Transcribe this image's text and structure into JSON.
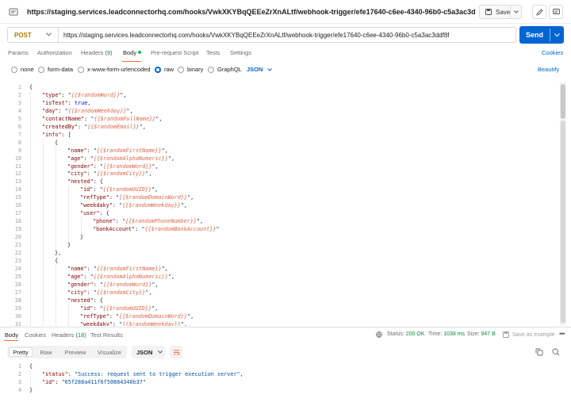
{
  "title_bar": {
    "url": "https://staging.services.leadconnectorhq.com/hooks/VwkXKYBqQEEeZrXnALtf/webhook-trigger/efe17640-c6ee-4340-96b0-c5a3ac3d",
    "save_label": "Save"
  },
  "request": {
    "method": "POST",
    "url": "https://staging.services.leadconnectorhq.com/hooks/VwkXKYBqQEEeZrXnALtf/webhook-trigger/efe17640-c6ee-4340-96b0-c5a3ac3ddf8f",
    "send_label": "Send"
  },
  "request_tabs": {
    "params": "Params",
    "authorization": "Authorization",
    "headers": "Headers",
    "headers_count": "(9)",
    "body": "Body",
    "pre_request": "Pre-request Script",
    "tests": "Tests",
    "settings": "Settings",
    "cookies": "Cookies"
  },
  "body_types": {
    "none": "none",
    "form_data": "form-data",
    "urlencoded": "x-www-form-urlencoded",
    "raw": "raw",
    "binary": "binary",
    "graphql": "GraphQL",
    "format": "JSON",
    "beautify": "Beautify"
  },
  "body_code": [
    {
      "n": "1",
      "t": [
        [
          "p",
          "{"
        ]
      ]
    },
    {
      "n": "2",
      "t": [
        [
          "k",
          "\"type\""
        ],
        [
          "p",
          ": "
        ],
        [
          "s",
          "\""
        ],
        [
          "v",
          "{{$randomWord}}"
        ],
        [
          "s",
          "\""
        ],
        [
          "p",
          ","
        ]
      ]
    },
    {
      "n": "3",
      "t": [
        [
          "k",
          "\"isTest\""
        ],
        [
          "p",
          ": "
        ],
        [
          "b",
          "true"
        ],
        [
          "p",
          ","
        ]
      ]
    },
    {
      "n": "4",
      "t": [
        [
          "k",
          "\"day\""
        ],
        [
          "p",
          ": "
        ],
        [
          "s",
          "\""
        ],
        [
          "v",
          "{{$randomWeekday}}"
        ],
        [
          "s",
          "\""
        ],
        [
          "p",
          ","
        ]
      ]
    },
    {
      "n": "5",
      "t": [
        [
          "k",
          "\"contactName\""
        ],
        [
          "p",
          ": "
        ],
        [
          "s",
          "\""
        ],
        [
          "v",
          "{{$randomFullName}}"
        ],
        [
          "s",
          "\""
        ],
        [
          "p",
          ","
        ]
      ]
    },
    {
      "n": "6",
      "t": [
        [
          "k",
          "\"createdBy\""
        ],
        [
          "p",
          ": "
        ],
        [
          "s",
          "\""
        ],
        [
          "v",
          "{{$randomEmail}}"
        ],
        [
          "s",
          "\""
        ],
        [
          "p",
          ","
        ]
      ]
    },
    {
      "n": "7",
      "t": [
        [
          "k",
          "\"info\""
        ],
        [
          "p",
          ": ["
        ]
      ]
    },
    {
      "n": "8",
      "t": [
        [
          "p",
          "{"
        ]
      ]
    },
    {
      "n": "9",
      "t": [
        [
          "k",
          "\"name\""
        ],
        [
          "p",
          ": "
        ],
        [
          "s",
          "\""
        ],
        [
          "v",
          "{{$randomFirstName}}"
        ],
        [
          "s",
          "\""
        ],
        [
          "p",
          ","
        ]
      ]
    },
    {
      "n": "10",
      "t": [
        [
          "k",
          "\"age\""
        ],
        [
          "p",
          ": "
        ],
        [
          "s",
          "\""
        ],
        [
          "v",
          "{{$randomAlphaNumeric}}"
        ],
        [
          "s",
          "\""
        ],
        [
          "p",
          ","
        ]
      ]
    },
    {
      "n": "11",
      "t": [
        [
          "k",
          "\"gender\""
        ],
        [
          "p",
          ": "
        ],
        [
          "s",
          "\""
        ],
        [
          "v",
          "{{$randomWord}}"
        ],
        [
          "s",
          "\""
        ],
        [
          "p",
          ","
        ]
      ]
    },
    {
      "n": "12",
      "t": [
        [
          "k",
          "\"city\""
        ],
        [
          "p",
          ": "
        ],
        [
          "s",
          "\""
        ],
        [
          "v",
          "{{$randomCity}}"
        ],
        [
          "s",
          "\""
        ],
        [
          "p",
          ","
        ]
      ]
    },
    {
      "n": "13",
      "t": [
        [
          "k",
          "\"nested\""
        ],
        [
          "p",
          ": {"
        ]
      ]
    },
    {
      "n": "14",
      "t": [
        [
          "k",
          "\"id\""
        ],
        [
          "p",
          ": "
        ],
        [
          "s",
          "\""
        ],
        [
          "v",
          "{{$randomUUID}}"
        ],
        [
          "s",
          "\""
        ],
        [
          "p",
          ","
        ]
      ]
    },
    {
      "n": "15",
      "t": [
        [
          "k",
          "\"refType\""
        ],
        [
          "p",
          ": "
        ],
        [
          "s",
          "\""
        ],
        [
          "v",
          "{{$randomDomainWord}}"
        ],
        [
          "s",
          "\""
        ],
        [
          "p",
          ","
        ]
      ]
    },
    {
      "n": "16",
      "t": [
        [
          "k",
          "\"weekdaky\""
        ],
        [
          "p",
          ": "
        ],
        [
          "s",
          "\""
        ],
        [
          "v",
          "{{$randomWeekday}}"
        ],
        [
          "s",
          "\""
        ],
        [
          "p",
          ","
        ]
      ]
    },
    {
      "n": "17",
      "t": [
        [
          "k",
          "\"user\""
        ],
        [
          "p",
          ": {"
        ]
      ]
    },
    {
      "n": "18",
      "t": [
        [
          "k",
          "\"phone\""
        ],
        [
          "p",
          ": "
        ],
        [
          "s",
          "\""
        ],
        [
          "v",
          "{{$randomPhoneNumber}}"
        ],
        [
          "s",
          "\""
        ],
        [
          "p",
          ","
        ]
      ]
    },
    {
      "n": "19",
      "t": [
        [
          "k",
          "\"bankAccount\""
        ],
        [
          "p",
          ": "
        ],
        [
          "s",
          "\""
        ],
        [
          "v",
          "{{$randomBankAccount}}"
        ],
        [
          "s",
          "\""
        ]
      ]
    },
    {
      "n": "20",
      "t": [
        [
          "p",
          "}"
        ]
      ]
    },
    {
      "n": "21",
      "t": [
        [
          "p",
          "}"
        ]
      ]
    },
    {
      "n": "22",
      "t": [
        [
          "p",
          "},"
        ]
      ]
    },
    {
      "n": "23",
      "t": [
        [
          "p",
          "{"
        ]
      ]
    },
    {
      "n": "24",
      "t": [
        [
          "k",
          "\"name\""
        ],
        [
          "p",
          ": "
        ],
        [
          "s",
          "\""
        ],
        [
          "v",
          "{{$randomFirstName}}"
        ],
        [
          "s",
          "\""
        ],
        [
          "p",
          ","
        ]
      ]
    },
    {
      "n": "25",
      "t": [
        [
          "k",
          "\"age\""
        ],
        [
          "p",
          ": "
        ],
        [
          "s",
          "\""
        ],
        [
          "v",
          "{{$randomAlphaNumeric}}"
        ],
        [
          "s",
          "\""
        ],
        [
          "p",
          ","
        ]
      ]
    },
    {
      "n": "26",
      "t": [
        [
          "k",
          "\"gender\""
        ],
        [
          "p",
          ": "
        ],
        [
          "s",
          "\""
        ],
        [
          "v",
          "{{$randomWord}}"
        ],
        [
          "s",
          "\""
        ],
        [
          "p",
          ","
        ]
      ]
    },
    {
      "n": "27",
      "t": [
        [
          "k",
          "\"city\""
        ],
        [
          "p",
          ": "
        ],
        [
          "s",
          "\""
        ],
        [
          "v",
          "{{$randomCity}}"
        ],
        [
          "s",
          "\""
        ],
        [
          "p",
          ","
        ]
      ]
    },
    {
      "n": "28",
      "t": [
        [
          "k",
          "\"nested\""
        ],
        [
          "p",
          ": {"
        ]
      ]
    },
    {
      "n": "29",
      "t": [
        [
          "k",
          "\"id\""
        ],
        [
          "p",
          ": "
        ],
        [
          "s",
          "\""
        ],
        [
          "v",
          "{{$randomUUID}}"
        ],
        [
          "s",
          "\""
        ],
        [
          "p",
          ","
        ]
      ]
    },
    {
      "n": "30",
      "t": [
        [
          "k",
          "\"refType\""
        ],
        [
          "p",
          ": "
        ],
        [
          "s",
          "\""
        ],
        [
          "v",
          "{{$randomDomainWord}}"
        ],
        [
          "s",
          "\""
        ],
        [
          "p",
          ","
        ]
      ]
    },
    {
      "n": "31",
      "t": [
        [
          "k",
          "\"weekdaky\""
        ],
        [
          "p",
          ": "
        ],
        [
          "s",
          "\""
        ],
        [
          "v",
          "{{$randomWeekday}}"
        ],
        [
          "s",
          "\""
        ],
        [
          "p",
          ","
        ]
      ]
    }
  ],
  "response_tabs": {
    "body": "Body",
    "cookies": "Cookies",
    "headers": "Headers",
    "headers_count": "(18)",
    "test_results": "Test Results"
  },
  "response_meta": {
    "status_label": "Status:",
    "status_value": "200 OK",
    "time_label": "Time:",
    "time_value": "1038 ms",
    "size_label": "Size:",
    "size_value": "947 B",
    "save_example": "Save as example"
  },
  "response_view": {
    "pretty": "Pretty",
    "raw": "Raw",
    "preview": "Preview",
    "visualize": "Visualize",
    "format": "JSON"
  },
  "response_code": [
    {
      "n": "1",
      "t": [
        [
          "p",
          "{"
        ]
      ]
    },
    {
      "n": "2",
      "t": [
        [
          "k",
          "\"status\""
        ],
        [
          "p",
          ": "
        ],
        [
          "s",
          "\"Success: request sent to trigger execution server\""
        ],
        [
          "p",
          ","
        ]
      ]
    },
    {
      "n": "3",
      "t": [
        [
          "k",
          "\"id\""
        ],
        [
          "p",
          ": "
        ],
        [
          "s",
          "\"65f288a411f6f50884340b37\""
        ]
      ]
    },
    {
      "n": "4",
      "t": [
        [
          "p",
          "}"
        ]
      ]
    }
  ],
  "colors": {
    "accent_orange": "#ff6c37",
    "send_blue": "#0265d2",
    "method_post": "#ad7a03",
    "status_ok": "#0a8a3a",
    "variable": "#e0674a"
  },
  "icons": [
    "http-request-icon",
    "save-icon",
    "chevron-down-icon",
    "edit-icon",
    "comment-icon",
    "globe-icon",
    "wrap-lines-icon",
    "copy-icon",
    "search-icon",
    "more-icon"
  ]
}
